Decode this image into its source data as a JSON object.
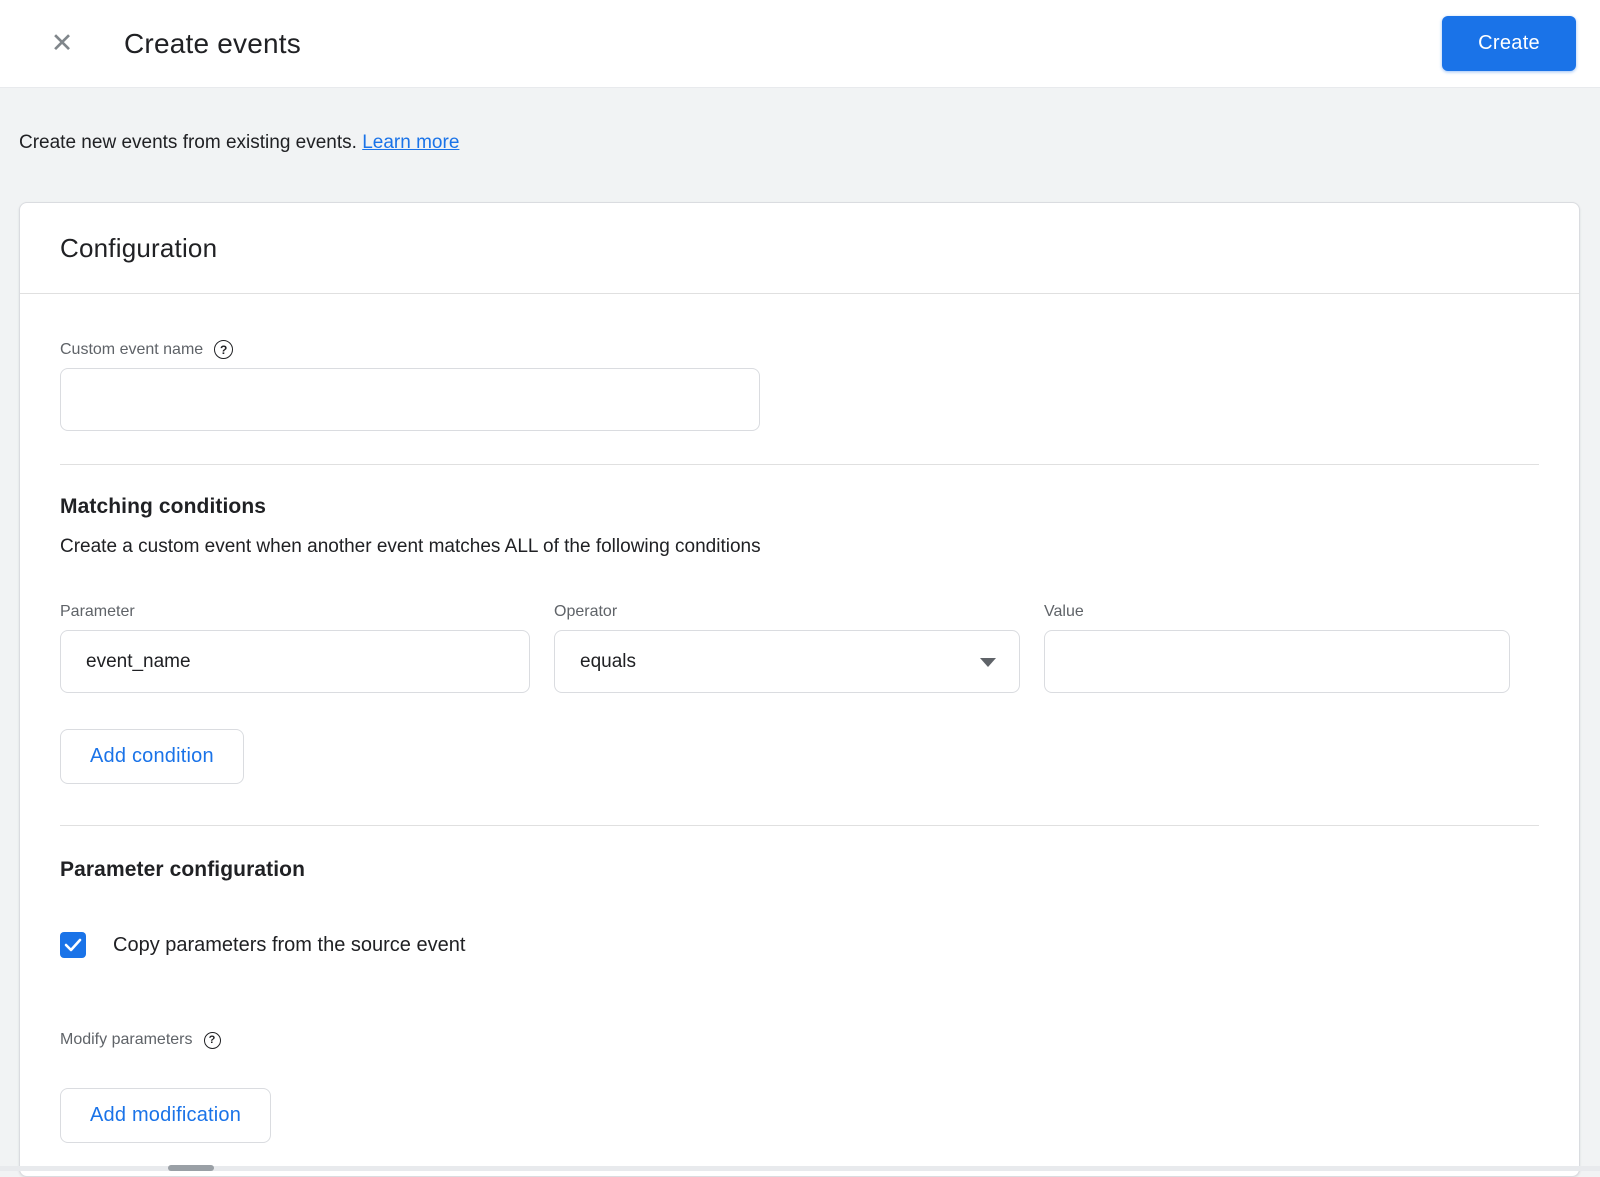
{
  "header": {
    "title": "Create events",
    "create_button": "Create"
  },
  "icons": {
    "close": "✕",
    "help": "?"
  },
  "intro": {
    "text": "Create new events from existing events.",
    "link": "Learn more"
  },
  "card": {
    "title": "Configuration",
    "custom_event_name": {
      "label": "Custom event name",
      "value": ""
    },
    "matching_conditions": {
      "heading": "Matching conditions",
      "description": "Create a custom event when another event matches ALL of the following conditions",
      "parameter": {
        "label": "Parameter",
        "value": "event_name"
      },
      "operator": {
        "label": "Operator",
        "selected": "equals"
      },
      "value": {
        "label": "Value",
        "value": ""
      },
      "add_condition_button": "Add condition"
    },
    "parameter_configuration": {
      "heading": "Parameter configuration",
      "copy_checkbox": {
        "checked": true,
        "label": "Copy parameters from the source event"
      },
      "modify_parameters_label": "Modify parameters",
      "add_modification_button": "Add modification"
    }
  },
  "colors": {
    "accent": "#1a73e8",
    "text": "#202124",
    "muted_text": "#5f6368",
    "border": "#dadce0",
    "page_background": "#f1f3f4"
  }
}
